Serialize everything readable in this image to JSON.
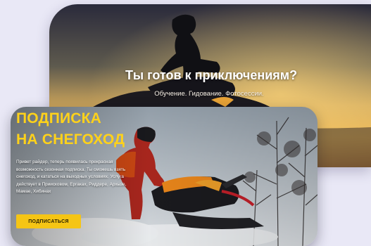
{
  "hero": {
    "title": "Ты готов к приключениям?",
    "subtitle": "Обучение. Гидование. Фотосессии."
  },
  "subscription": {
    "title_line1": "ПОДПИСКА",
    "title_line2": "НА СНЕГОХОД",
    "description": "Привет райдер, теперь появилась прекрасная возможность сезонная подписка. Ты сможешь взять снегоход, и кататься на выходных условиях. Услуга действует в Приисковом, Ергаках, Риддере, Архызе, Мамае, Хибинах",
    "button_label": "ПОДПИСАТЬСЯ"
  },
  "colors": {
    "page_background": "#e9e8f6",
    "accent_yellow": "#f5c515",
    "title_yellow": "#ffd21a",
    "hero_text": "#ffffff"
  },
  "images": {
    "hero_photo": "rider-on-snowmobile-at-sunset",
    "subscription_photo": "rider-on-snowmobile-in-winter-forest"
  }
}
